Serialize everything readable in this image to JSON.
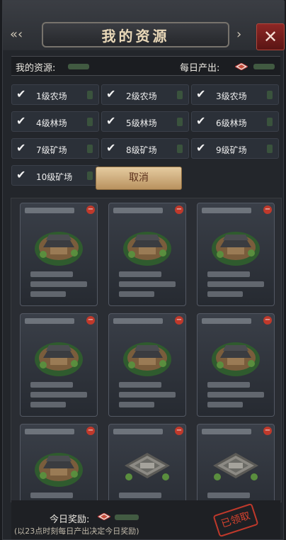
{
  "header": {
    "title": "我的资源",
    "close_glyph": "✕",
    "left_arrows": "«‹",
    "right_arrows": "›"
  },
  "resources": {
    "my_label": "我的资源:",
    "my_value": "",
    "daily_label": "每日产出:",
    "daily_value": ""
  },
  "filters": [
    {
      "label": "1级农场",
      "checked": true
    },
    {
      "label": "2级农场",
      "checked": true
    },
    {
      "label": "3级农场",
      "checked": true
    },
    {
      "label": "4级林场",
      "checked": true
    },
    {
      "label": "5级林场",
      "checked": true
    },
    {
      "label": "6级林场",
      "checked": true
    },
    {
      "label": "7级矿场",
      "checked": true
    },
    {
      "label": "8级矿场",
      "checked": true
    },
    {
      "label": "9级矿场",
      "checked": true
    },
    {
      "label": "10级矿场",
      "checked": true
    }
  ],
  "cancel_label": "取消",
  "cards": [
    {
      "type": "farm"
    },
    {
      "type": "farm"
    },
    {
      "type": "farm"
    },
    {
      "type": "farm"
    },
    {
      "type": "farm"
    },
    {
      "type": "farm"
    },
    {
      "type": "farm"
    },
    {
      "type": "compound"
    },
    {
      "type": "compound"
    }
  ],
  "footer": {
    "reward_label": "今日奖励:",
    "reward_value": "",
    "note": "(以23点时刻每日产出决定今日奖励)",
    "claimed_label": "已领取"
  },
  "colors": {
    "close_red": "#8d2725",
    "cancel_gold": "#e5cba0",
    "badge_red": "#c0392b"
  },
  "icons": {
    "check": "check-icon",
    "diamond": "diamond-icon",
    "close": "close-icon",
    "remove": "remove-badge-icon"
  }
}
